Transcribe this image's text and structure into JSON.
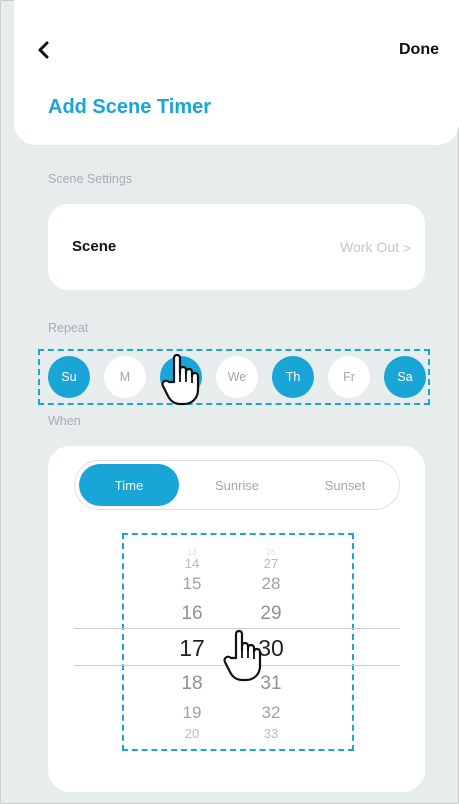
{
  "nav": {
    "done_label": "Done",
    "title": "Add Scene Timer"
  },
  "scene_settings": {
    "section_label": "Scene Settings",
    "scene_label": "Scene",
    "scene_value": "Work Out",
    "chevron": ">"
  },
  "repeat": {
    "section_label": "Repeat",
    "days": [
      {
        "label": "Su",
        "selected": true
      },
      {
        "label": "M",
        "selected": false
      },
      {
        "label": "Tu",
        "selected": true
      },
      {
        "label": "We",
        "selected": false
      },
      {
        "label": "Th",
        "selected": true
      },
      {
        "label": "Fr",
        "selected": false
      },
      {
        "label": "Sa",
        "selected": true
      }
    ]
  },
  "when": {
    "section_label": "When",
    "tabs": [
      {
        "label": "Time",
        "active": true
      },
      {
        "label": "Sunrise",
        "active": false
      },
      {
        "label": "Sunset",
        "active": false
      }
    ],
    "hours": [
      "14",
      "15",
      "16",
      "17",
      "18",
      "19",
      "20"
    ],
    "minutes": [
      "27",
      "28",
      "29",
      "30",
      "31",
      "32",
      "33"
    ],
    "selected_hour": "17",
    "selected_minute": "30"
  },
  "colors": {
    "accent": "#19a6d6",
    "background": "#e7ecec"
  },
  "icons": {
    "back": "chevron-left-icon",
    "pointer": "hand-pointer-icon"
  }
}
